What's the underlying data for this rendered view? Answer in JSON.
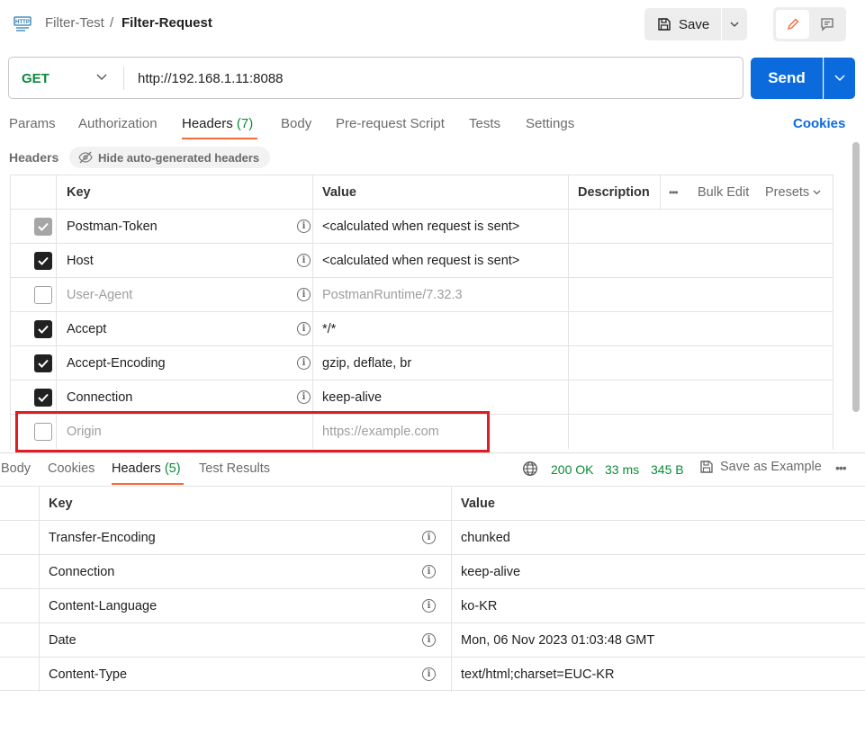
{
  "breadcrumb": {
    "collection": "Filter-Test",
    "separator": "/",
    "request": "Filter-Request"
  },
  "toolbar": {
    "save_label": "Save"
  },
  "request": {
    "method": "GET",
    "url": "http://192.168.1.11:8088",
    "send_label": "Send"
  },
  "request_tabs": [
    {
      "label": "Params"
    },
    {
      "label": "Authorization"
    },
    {
      "label": "Headers",
      "count": "(7)"
    },
    {
      "label": "Body"
    },
    {
      "label": "Pre-request Script"
    },
    {
      "label": "Tests"
    },
    {
      "label": "Settings"
    }
  ],
  "cookies_label": "Cookies",
  "headers_section": {
    "title": "Headers",
    "hide_label": "Hide auto-generated headers"
  },
  "request_table": {
    "columns": {
      "key": "Key",
      "value": "Value",
      "description": "Description",
      "more": "•••",
      "bulk_edit": "Bulk Edit",
      "presets": "Presets"
    },
    "rows": [
      {
        "key": "Postman-Token",
        "value": "<calculated when request is sent>",
        "checked": "locked"
      },
      {
        "key": "Host",
        "value": "<calculated when request is sent>",
        "checked": "on"
      },
      {
        "key": "User-Agent",
        "value": "PostmanRuntime/7.32.3",
        "checked": "off"
      },
      {
        "key": "Accept",
        "value": "*/*",
        "checked": "on"
      },
      {
        "key": "Accept-Encoding",
        "value": "gzip, deflate, br",
        "checked": "on"
      },
      {
        "key": "Connection",
        "value": "keep-alive",
        "checked": "on"
      },
      {
        "key": "Origin",
        "value": "https://example.com",
        "checked": "off"
      }
    ]
  },
  "response_tabs": [
    {
      "label": "Body"
    },
    {
      "label": "Cookies"
    },
    {
      "label": "Headers",
      "count": "(5)"
    },
    {
      "label": "Test Results"
    }
  ],
  "response_status": {
    "code": "200 OK",
    "time": "33 ms",
    "size": "345 B",
    "save_example": "Save as Example",
    "more": "•••"
  },
  "response_table": {
    "columns": {
      "key": "Key",
      "value": "Value"
    },
    "rows": [
      {
        "key": "Transfer-Encoding",
        "value": "chunked"
      },
      {
        "key": "Connection",
        "value": "keep-alive"
      },
      {
        "key": "Content-Language",
        "value": "ko-KR"
      },
      {
        "key": "Date",
        "value": "Mon, 06 Nov 2023 01:03:48 GMT"
      },
      {
        "key": "Content-Type",
        "value": "text/html;charset=EUC-KR"
      }
    ]
  },
  "colors": {
    "accent_blue": "#0b6bdd",
    "success_green": "#0b8a3a",
    "tab_underline": "#f26b3a",
    "highlight_red": "#e01b24"
  }
}
